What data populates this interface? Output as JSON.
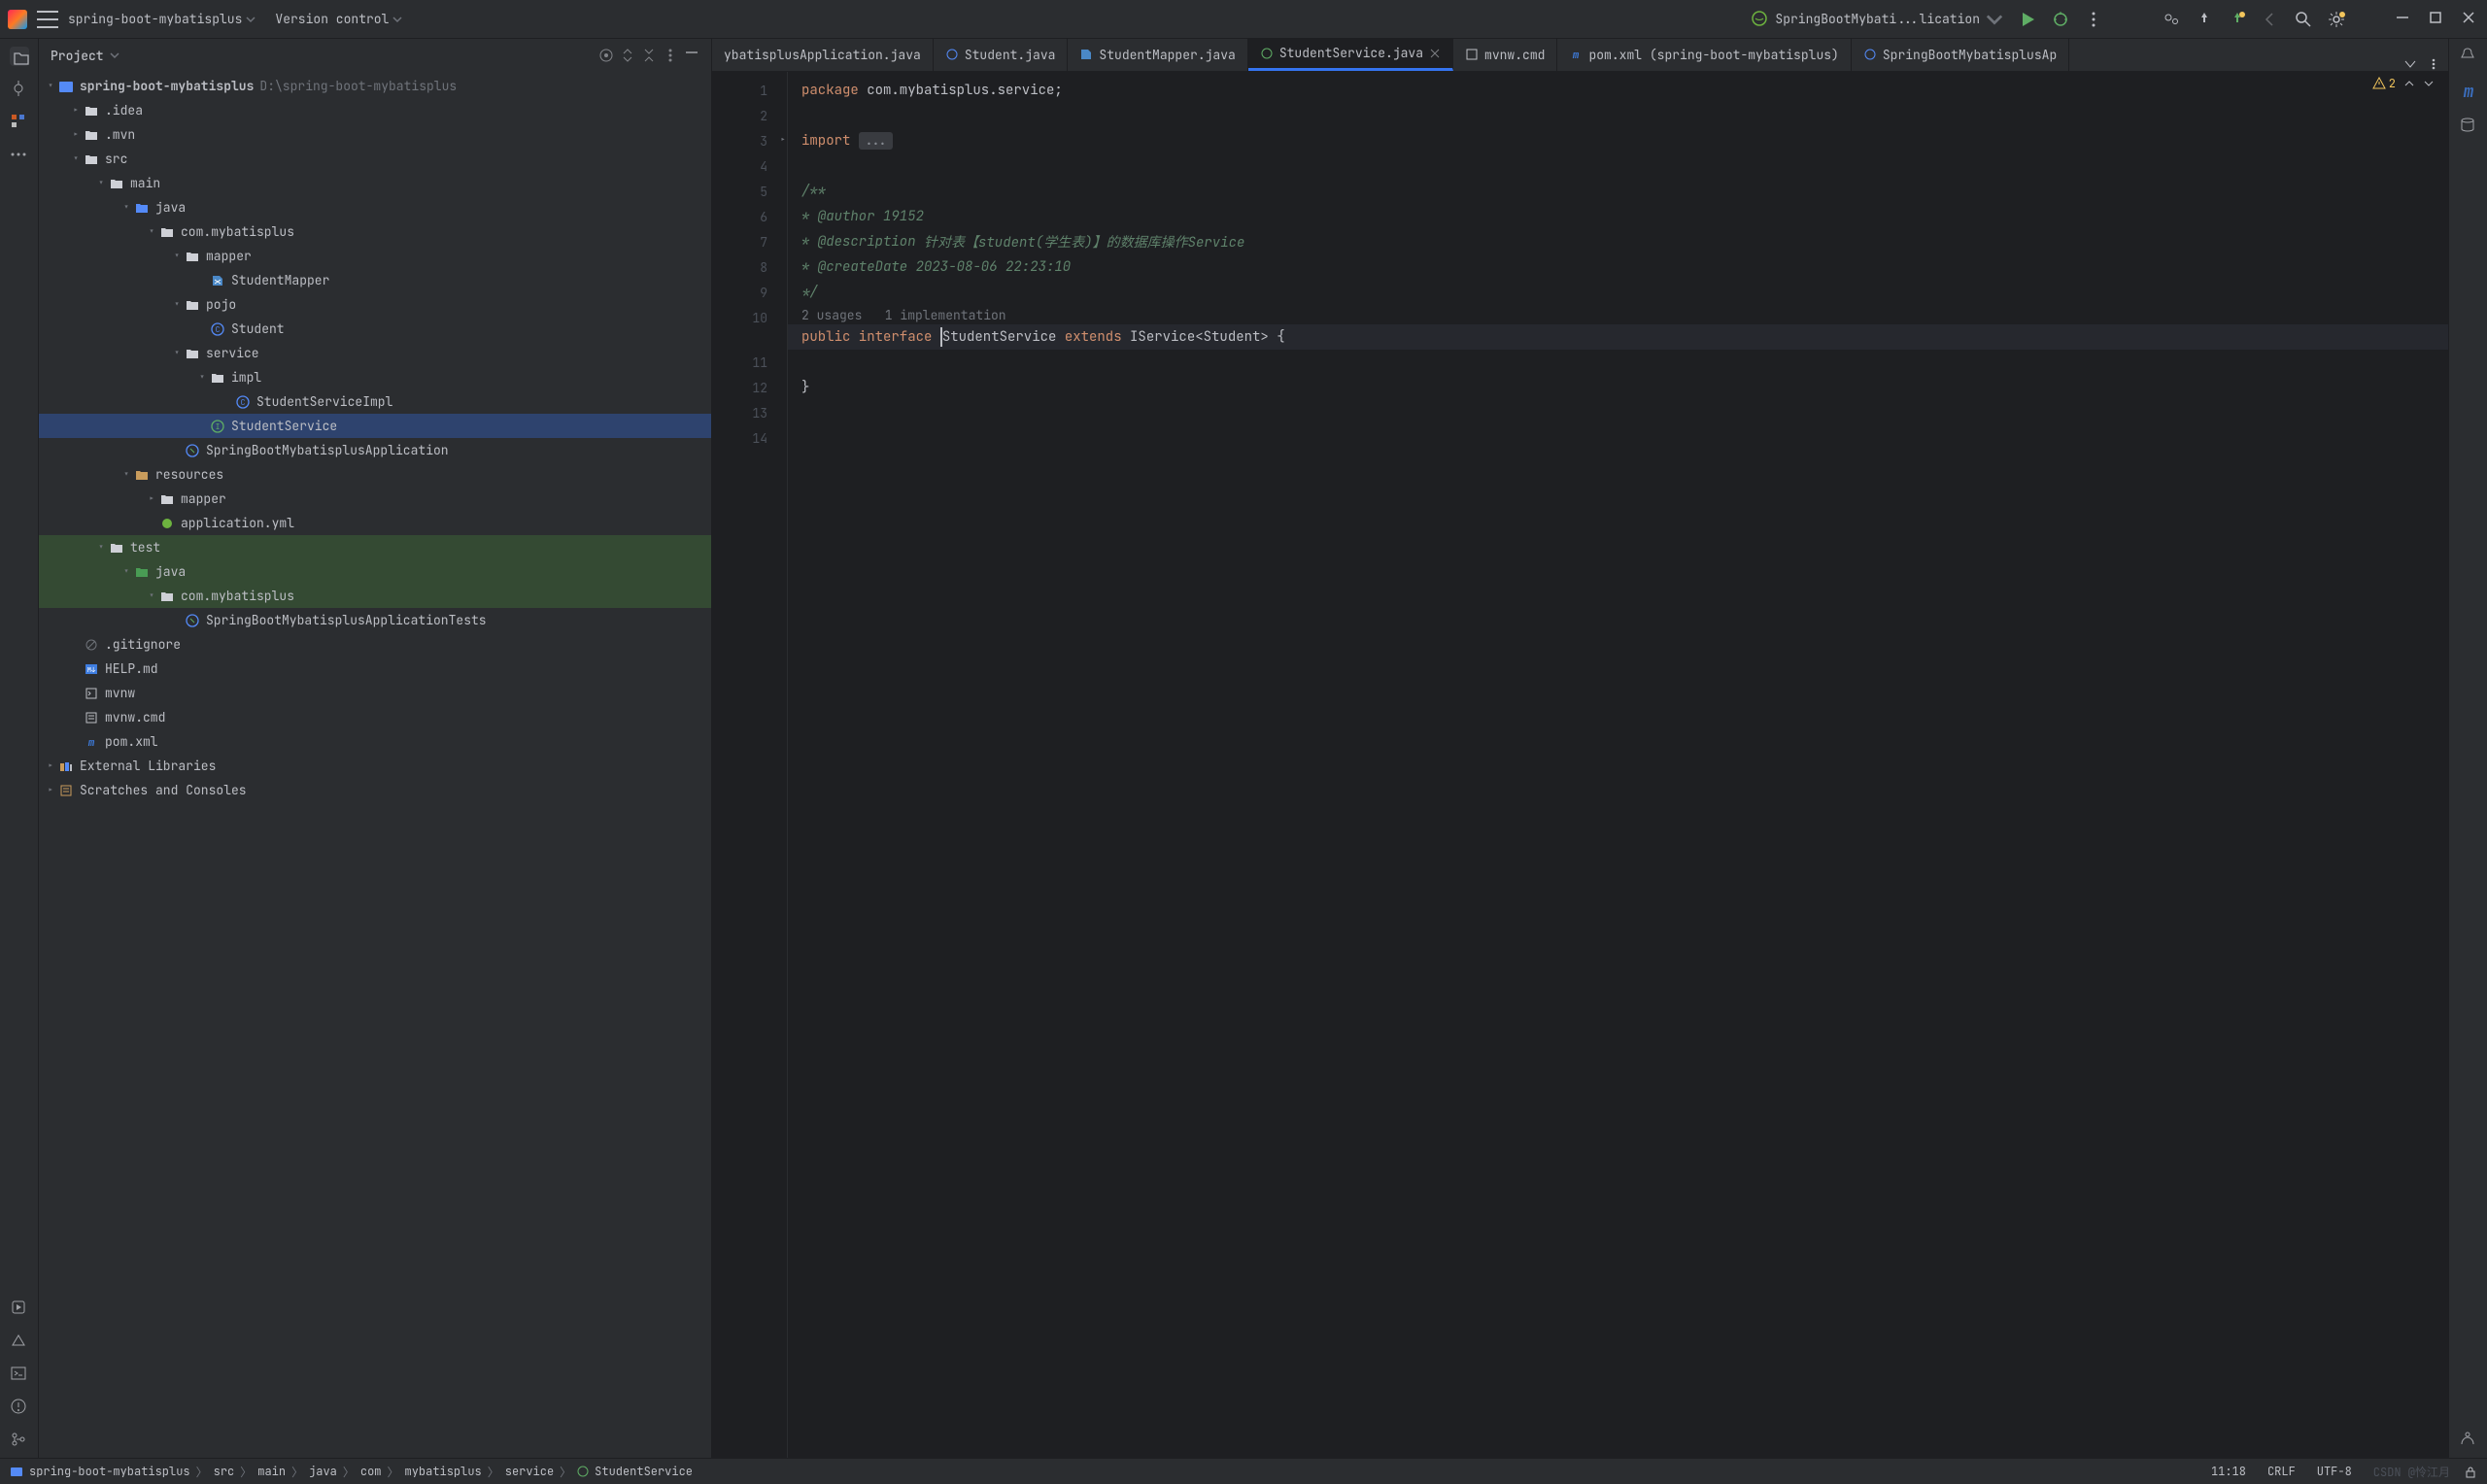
{
  "titlebar": {
    "project_name": "spring-boot-mybatisplus",
    "vcs": "Version control",
    "run_config": "SpringBootMybati...lication"
  },
  "panel": {
    "title": "Project"
  },
  "tree": {
    "root": "spring-boot-mybatisplus",
    "root_path": "D:\\spring-boot-mybatisplus",
    "idea": ".idea",
    "mvn": ".mvn",
    "src": "src",
    "main": "main",
    "java": "java",
    "com_mybatisplus": "com.mybatisplus",
    "mapper": "mapper",
    "student_mapper": "StudentMapper",
    "pojo": "pojo",
    "student": "Student",
    "service": "service",
    "impl": "impl",
    "student_service_impl": "StudentServiceImpl",
    "student_service": "StudentService",
    "app_class": "SpringBootMybatisplusApplication",
    "resources": "resources",
    "mapper2": "mapper",
    "appyml": "application.yml",
    "test": "test",
    "java2": "java",
    "com_mybatisplus2": "com.mybatisplus",
    "tests": "SpringBootMybatisplusApplicationTests",
    "gitignore": ".gitignore",
    "help": "HELP.md",
    "mvnw": "mvnw",
    "mvnwcmd": "mvnw.cmd",
    "pom": "pom.xml",
    "extlib": "External Libraries",
    "scratches": "Scratches and Consoles"
  },
  "tabs": {
    "t0": "ybatisplusApplication.java",
    "t1": "Student.java",
    "t2": "StudentMapper.java",
    "t3": "StudentService.java",
    "t4": "mvnw.cmd",
    "t5": "pom.xml (spring-boot-mybatisplus)",
    "t6": "SpringBootMybatisplusAp"
  },
  "code": {
    "l1_kw": "package",
    "l1_pkg": " com.mybatisplus.service;",
    "l3_kw": "import",
    "l3_fold": "...",
    "l5": "/**",
    "l6": "* @author",
    "l6b": " 19152",
    "l7": "* @description",
    "l7b": " 针对表【student(学生表)】的数据库操作Service",
    "l8": "* @createDate",
    "l8b": " 2023-08-06 22:23:10",
    "l9": "*/",
    "hint": "2 usages   1 implementation",
    "l11a": "public",
    "l11b": " interface",
    "l11c": " StudentService ",
    "l11d": "extends",
    "l11e": " IService<Student> {",
    "l13": "}",
    "lines": [
      "1",
      "2",
      "3",
      "4",
      "5",
      "6",
      "7",
      "8",
      "9",
      "10",
      "11",
      "12",
      "13",
      "14"
    ]
  },
  "insp": {
    "warn_count": "2"
  },
  "breadcrumb": {
    "b0": "spring-boot-mybatisplus",
    "b1": "src",
    "b2": "main",
    "b3": "java",
    "b4": "com",
    "b5": "mybatisplus",
    "b6": "service",
    "b7": "StudentService"
  },
  "status": {
    "pos": "11:18",
    "sep": "CRLF",
    "enc": "UTF-8",
    "wm": "CSDN @怜江月"
  }
}
